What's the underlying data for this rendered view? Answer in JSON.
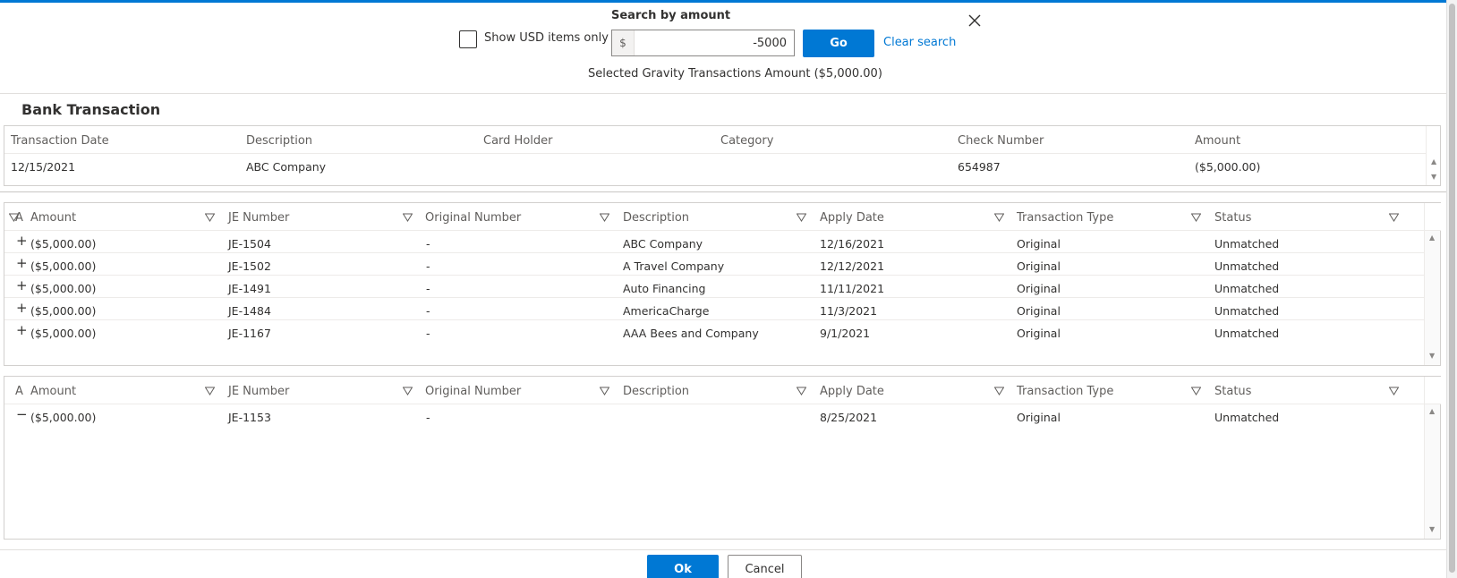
{
  "search": {
    "title": "Search by amount",
    "usd_only_label": "Show USD items only",
    "usd_only_checked": false,
    "currency_symbol": "$",
    "amount_value": "-5000",
    "go_label": "Go",
    "clear_label": "Clear search",
    "selected_text": "Selected Gravity Transactions Amount ($5,000.00)"
  },
  "bank": {
    "title": "Bank Transaction",
    "columns": [
      "Transaction Date",
      "Description",
      "Card Holder",
      "Category",
      "Check Number",
      "Amount"
    ],
    "row": {
      "transaction_date": "12/15/2021",
      "description": "ABC Company",
      "card_holder": "",
      "category": "",
      "check_number": "654987",
      "amount": "($5,000.00)"
    }
  },
  "je_columns": {
    "amount": "Amount",
    "je_number": "JE Number",
    "original_number": "Original Number",
    "description": "Description",
    "apply_date": "Apply Date",
    "transaction_type": "Transaction Type",
    "status": "Status"
  },
  "unmatched_grid": {
    "rows": [
      {
        "expander": "+",
        "amount": "($5,000.00)",
        "je_number": "JE-1504",
        "original_number": "-",
        "description": "ABC Company",
        "apply_date": "12/16/2021",
        "transaction_type": "Original",
        "status": "Unmatched"
      },
      {
        "expander": "+",
        "amount": "($5,000.00)",
        "je_number": "JE-1502",
        "original_number": "-",
        "description": "A Travel Company",
        "apply_date": "12/12/2021",
        "transaction_type": "Original",
        "status": "Unmatched"
      },
      {
        "expander": "+",
        "amount": "($5,000.00)",
        "je_number": "JE-1491",
        "original_number": "-",
        "description": "Auto Financing",
        "apply_date": "11/11/2021",
        "transaction_type": "Original",
        "status": "Unmatched"
      },
      {
        "expander": "+",
        "amount": "($5,000.00)",
        "je_number": "JE-1484",
        "original_number": "-",
        "description": "AmericaCharge",
        "apply_date": "11/3/2021",
        "transaction_type": "Original",
        "status": "Unmatched"
      },
      {
        "expander": "+",
        "amount": "($5,000.00)",
        "je_number": "JE-1167",
        "original_number": "-",
        "description": "AAA Bees and Company",
        "apply_date": "9/1/2021",
        "transaction_type": "Original",
        "status": "Unmatched"
      }
    ]
  },
  "selected_grid": {
    "rows": [
      {
        "expander": "−",
        "amount": "($5,000.00)",
        "je_number": "JE-1153",
        "original_number": "-",
        "description": "",
        "apply_date": "8/25/2021",
        "transaction_type": "Original",
        "status": "Unmatched"
      }
    ]
  },
  "footer": {
    "ok_label": "Ok",
    "cancel_label": "Cancel"
  },
  "colors": {
    "accent": "#0078d4",
    "border": "#d2d0ce",
    "text": "#323130"
  },
  "icons": [
    "close-icon",
    "filter-icon",
    "expand-icon",
    "collapse-icon",
    "scroll-up-icon",
    "scroll-down-icon"
  ]
}
